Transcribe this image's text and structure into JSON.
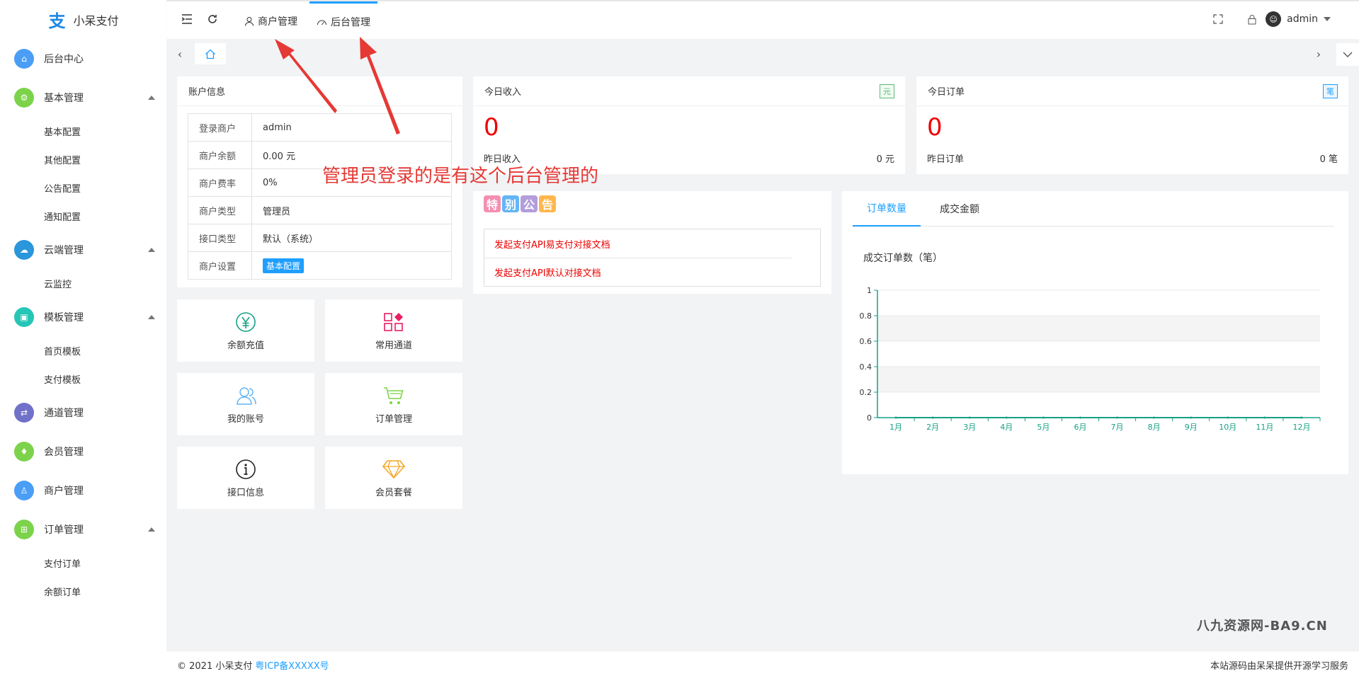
{
  "app": {
    "name": "小呆支付"
  },
  "sidebar": {
    "items": [
      {
        "label": "后台中心",
        "color": "#4a9ef5",
        "icon": "home-icon",
        "expanded": false,
        "children": []
      },
      {
        "label": "基本管理",
        "color": "#7cd34b",
        "icon": "settings-icon",
        "expanded": true,
        "children": [
          "基本配置",
          "其他配置",
          "公告配置",
          "通知配置"
        ]
      },
      {
        "label": "云端管理",
        "color": "#2a96db",
        "icon": "cloud-icon",
        "expanded": true,
        "children": [
          "云监控"
        ]
      },
      {
        "label": "模板管理",
        "color": "#26c6b6",
        "icon": "template-icon",
        "expanded": true,
        "children": [
          "首页模板",
          "支付模板"
        ]
      },
      {
        "label": "通道管理",
        "color": "#7071c8",
        "icon": "channel-icon",
        "expanded": false,
        "children": []
      },
      {
        "label": "会员管理",
        "color": "#7cd34b",
        "icon": "member-icon",
        "expanded": false,
        "children": []
      },
      {
        "label": "商户管理",
        "color": "#4a9ef5",
        "icon": "merchant-icon",
        "expanded": false,
        "children": []
      },
      {
        "label": "订单管理",
        "color": "#7cd34b",
        "icon": "cart-icon",
        "expanded": true,
        "children": [
          "支付订单",
          "余额订单"
        ]
      }
    ]
  },
  "topbar": {
    "tabs": [
      "商户管理",
      "后台管理"
    ],
    "active_tab": 1,
    "user": "admin"
  },
  "account": {
    "title": "账户信息",
    "rows": [
      {
        "k": "登录商户",
        "v": "admin"
      },
      {
        "k": "商户余额",
        "v": "0.00 元"
      },
      {
        "k": "商户费率",
        "v": "0%"
      },
      {
        "k": "商户类型",
        "v": "管理员"
      },
      {
        "k": "接口类型",
        "v": "默认（系统）"
      },
      {
        "k": "商户设置",
        "v": "基本配置"
      }
    ]
  },
  "income": {
    "title": "今日收入",
    "tag": "元",
    "value": "0",
    "foot_label": "昨日收入",
    "foot_value": "0 元",
    "tag_color": "#5fb878"
  },
  "orders": {
    "title": "今日订单",
    "tag": "笔",
    "value": "0",
    "foot_label": "昨日订单",
    "foot_value": "0 笔",
    "tag_color": "#1e9fff"
  },
  "tiles": [
    {
      "label": "余额充值",
      "icon": "yen-icon"
    },
    {
      "label": "常用通道",
      "icon": "grid-icon"
    },
    {
      "label": "我的账号",
      "icon": "users-icon"
    },
    {
      "label": "订单管理",
      "icon": "cart-icon"
    },
    {
      "label": "接口信息",
      "icon": "info-icon"
    },
    {
      "label": "会员套餐",
      "icon": "diamond-icon"
    }
  ],
  "notice": {
    "title_chars": [
      "特",
      "别",
      "公",
      "告"
    ],
    "title_colors": [
      "#f48fb1",
      "#64b5f6",
      "#b39ddb",
      "#ffb74d"
    ],
    "links": [
      "发起支付API易支付对接文档",
      "发起支付API默认对接文档"
    ]
  },
  "chart_card": {
    "tabs": [
      "订单数量",
      "成交金额"
    ],
    "active_tab": 0
  },
  "chart_data": {
    "type": "line",
    "title": "成交订单数（笔）",
    "categories": [
      "1月",
      "2月",
      "3月",
      "4月",
      "5月",
      "6月",
      "7月",
      "8月",
      "9月",
      "10月",
      "11月",
      "12月"
    ],
    "series": [
      {
        "values": [
          0,
          0,
          0,
          0,
          0,
          0,
          0,
          0,
          0,
          0,
          0,
          0
        ]
      }
    ],
    "ylim": [
      0,
      1
    ],
    "yticks": [
      "0",
      "0.2",
      "0.4",
      "0.6",
      "0.8",
      "1"
    ],
    "axis_color": "#16a085"
  },
  "annotation": {
    "text": "管理员登录的是有这个后台管理的",
    "color": "#e53935"
  },
  "footer": {
    "left": "© 2021 小呆支付",
    "icp": "粤ICP备XXXXX号",
    "right": "本站源码由呆呆提供开源学习服务"
  },
  "watermark": "八九资源网-BA9.CN"
}
